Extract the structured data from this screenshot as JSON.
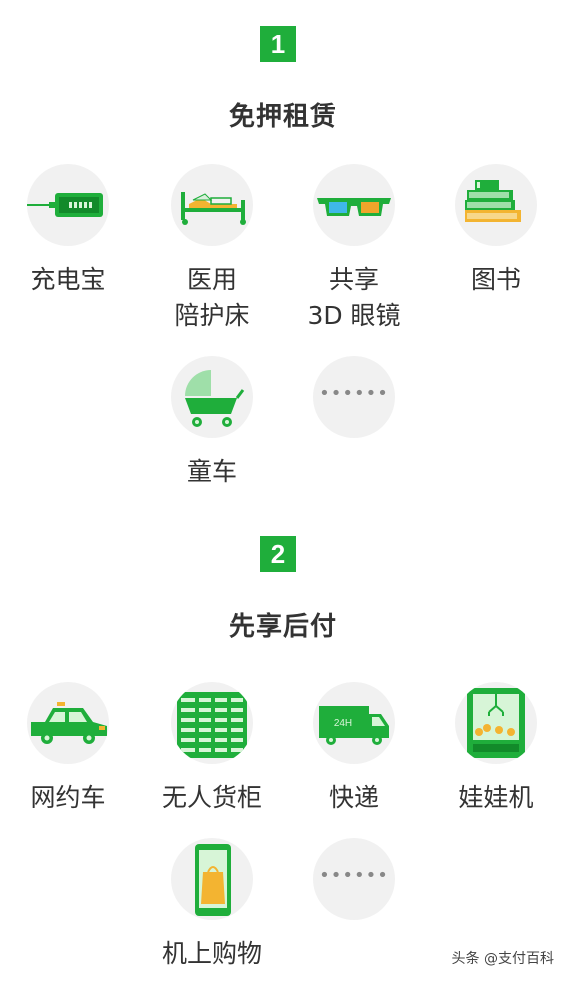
{
  "sections": [
    {
      "badge": "1",
      "title": "免押租赁",
      "items": [
        {
          "icon": "power-bank-icon",
          "label_lines": [
            "充电宝"
          ]
        },
        {
          "icon": "hospital-bed-icon",
          "label_lines": [
            "医用",
            "陪护床"
          ]
        },
        {
          "icon": "3d-glasses-icon",
          "label_lines": [
            "共享",
            "3D 眼镜"
          ]
        },
        {
          "icon": "books-icon",
          "label_lines": [
            "图书"
          ]
        },
        {
          "icon": "stroller-icon",
          "label_lines": [
            "童车"
          ]
        },
        {
          "icon": "more-icon",
          "label_lines": [],
          "dots": "••••••"
        }
      ]
    },
    {
      "badge": "2",
      "title": "先享后付",
      "items": [
        {
          "icon": "taxi-icon",
          "label_lines": [
            "网约车"
          ]
        },
        {
          "icon": "vending-locker-icon",
          "label_lines": [
            "无人货柜"
          ]
        },
        {
          "icon": "delivery-truck-icon",
          "label_lines": [
            "快递"
          ],
          "truck_text": "24H"
        },
        {
          "icon": "claw-machine-icon",
          "label_lines": [
            "娃娃机"
          ]
        },
        {
          "icon": "inflight-shopping-icon",
          "label_lines": [
            "机上购物"
          ]
        },
        {
          "icon": "more-icon",
          "label_lines": [],
          "dots": "••••••"
        }
      ]
    }
  ],
  "watermark": "头条 @支付百科",
  "colors": {
    "accent": "#1fae3b",
    "icon_bg": "#f1f1f1",
    "text": "#333333"
  }
}
